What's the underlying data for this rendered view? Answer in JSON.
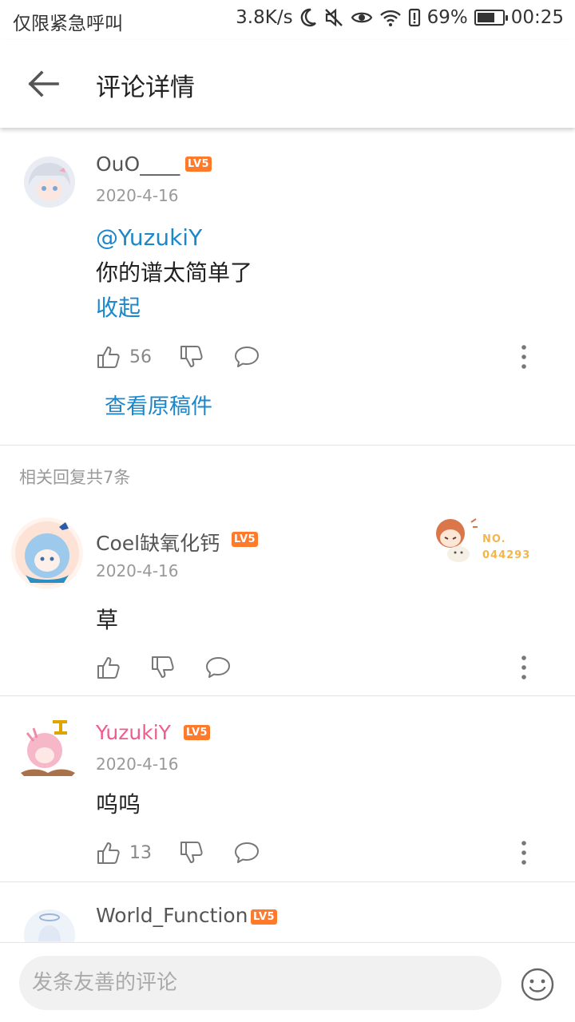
{
  "status_bar": {
    "left_text": "仅限紧急呼叫",
    "speed": "3.8K/s",
    "battery": "69%",
    "battery_level": 0.69,
    "time": "00:25"
  },
  "app_bar": {
    "title": "评论详情"
  },
  "main_comment": {
    "username": "OuO____",
    "level": "LV5",
    "date": "2020-4-16",
    "mention": "@YuzukiY",
    "text": "你的谱太简单了",
    "collapse": "收起",
    "likes": "56",
    "view_original": "查看原稿件"
  },
  "related_title": "相关回复共7条",
  "replies": [
    {
      "username": "Coel缺氧化钙",
      "level": "LV5",
      "date": "2020-4-16",
      "text": "草",
      "likes": "",
      "badge_label": "NO.",
      "badge_number": "044293"
    },
    {
      "username": "YuzukiY",
      "level": "LV5",
      "date": "2020-4-16",
      "text": "呜呜",
      "likes": "13"
    },
    {
      "username": "World_Function",
      "level": "LV5"
    }
  ],
  "input": {
    "placeholder": "发条友善的评论"
  },
  "colors": {
    "link": "#1c87c9",
    "level_badge": "#ff7a2a",
    "pink_name": "#ef5b8e"
  }
}
